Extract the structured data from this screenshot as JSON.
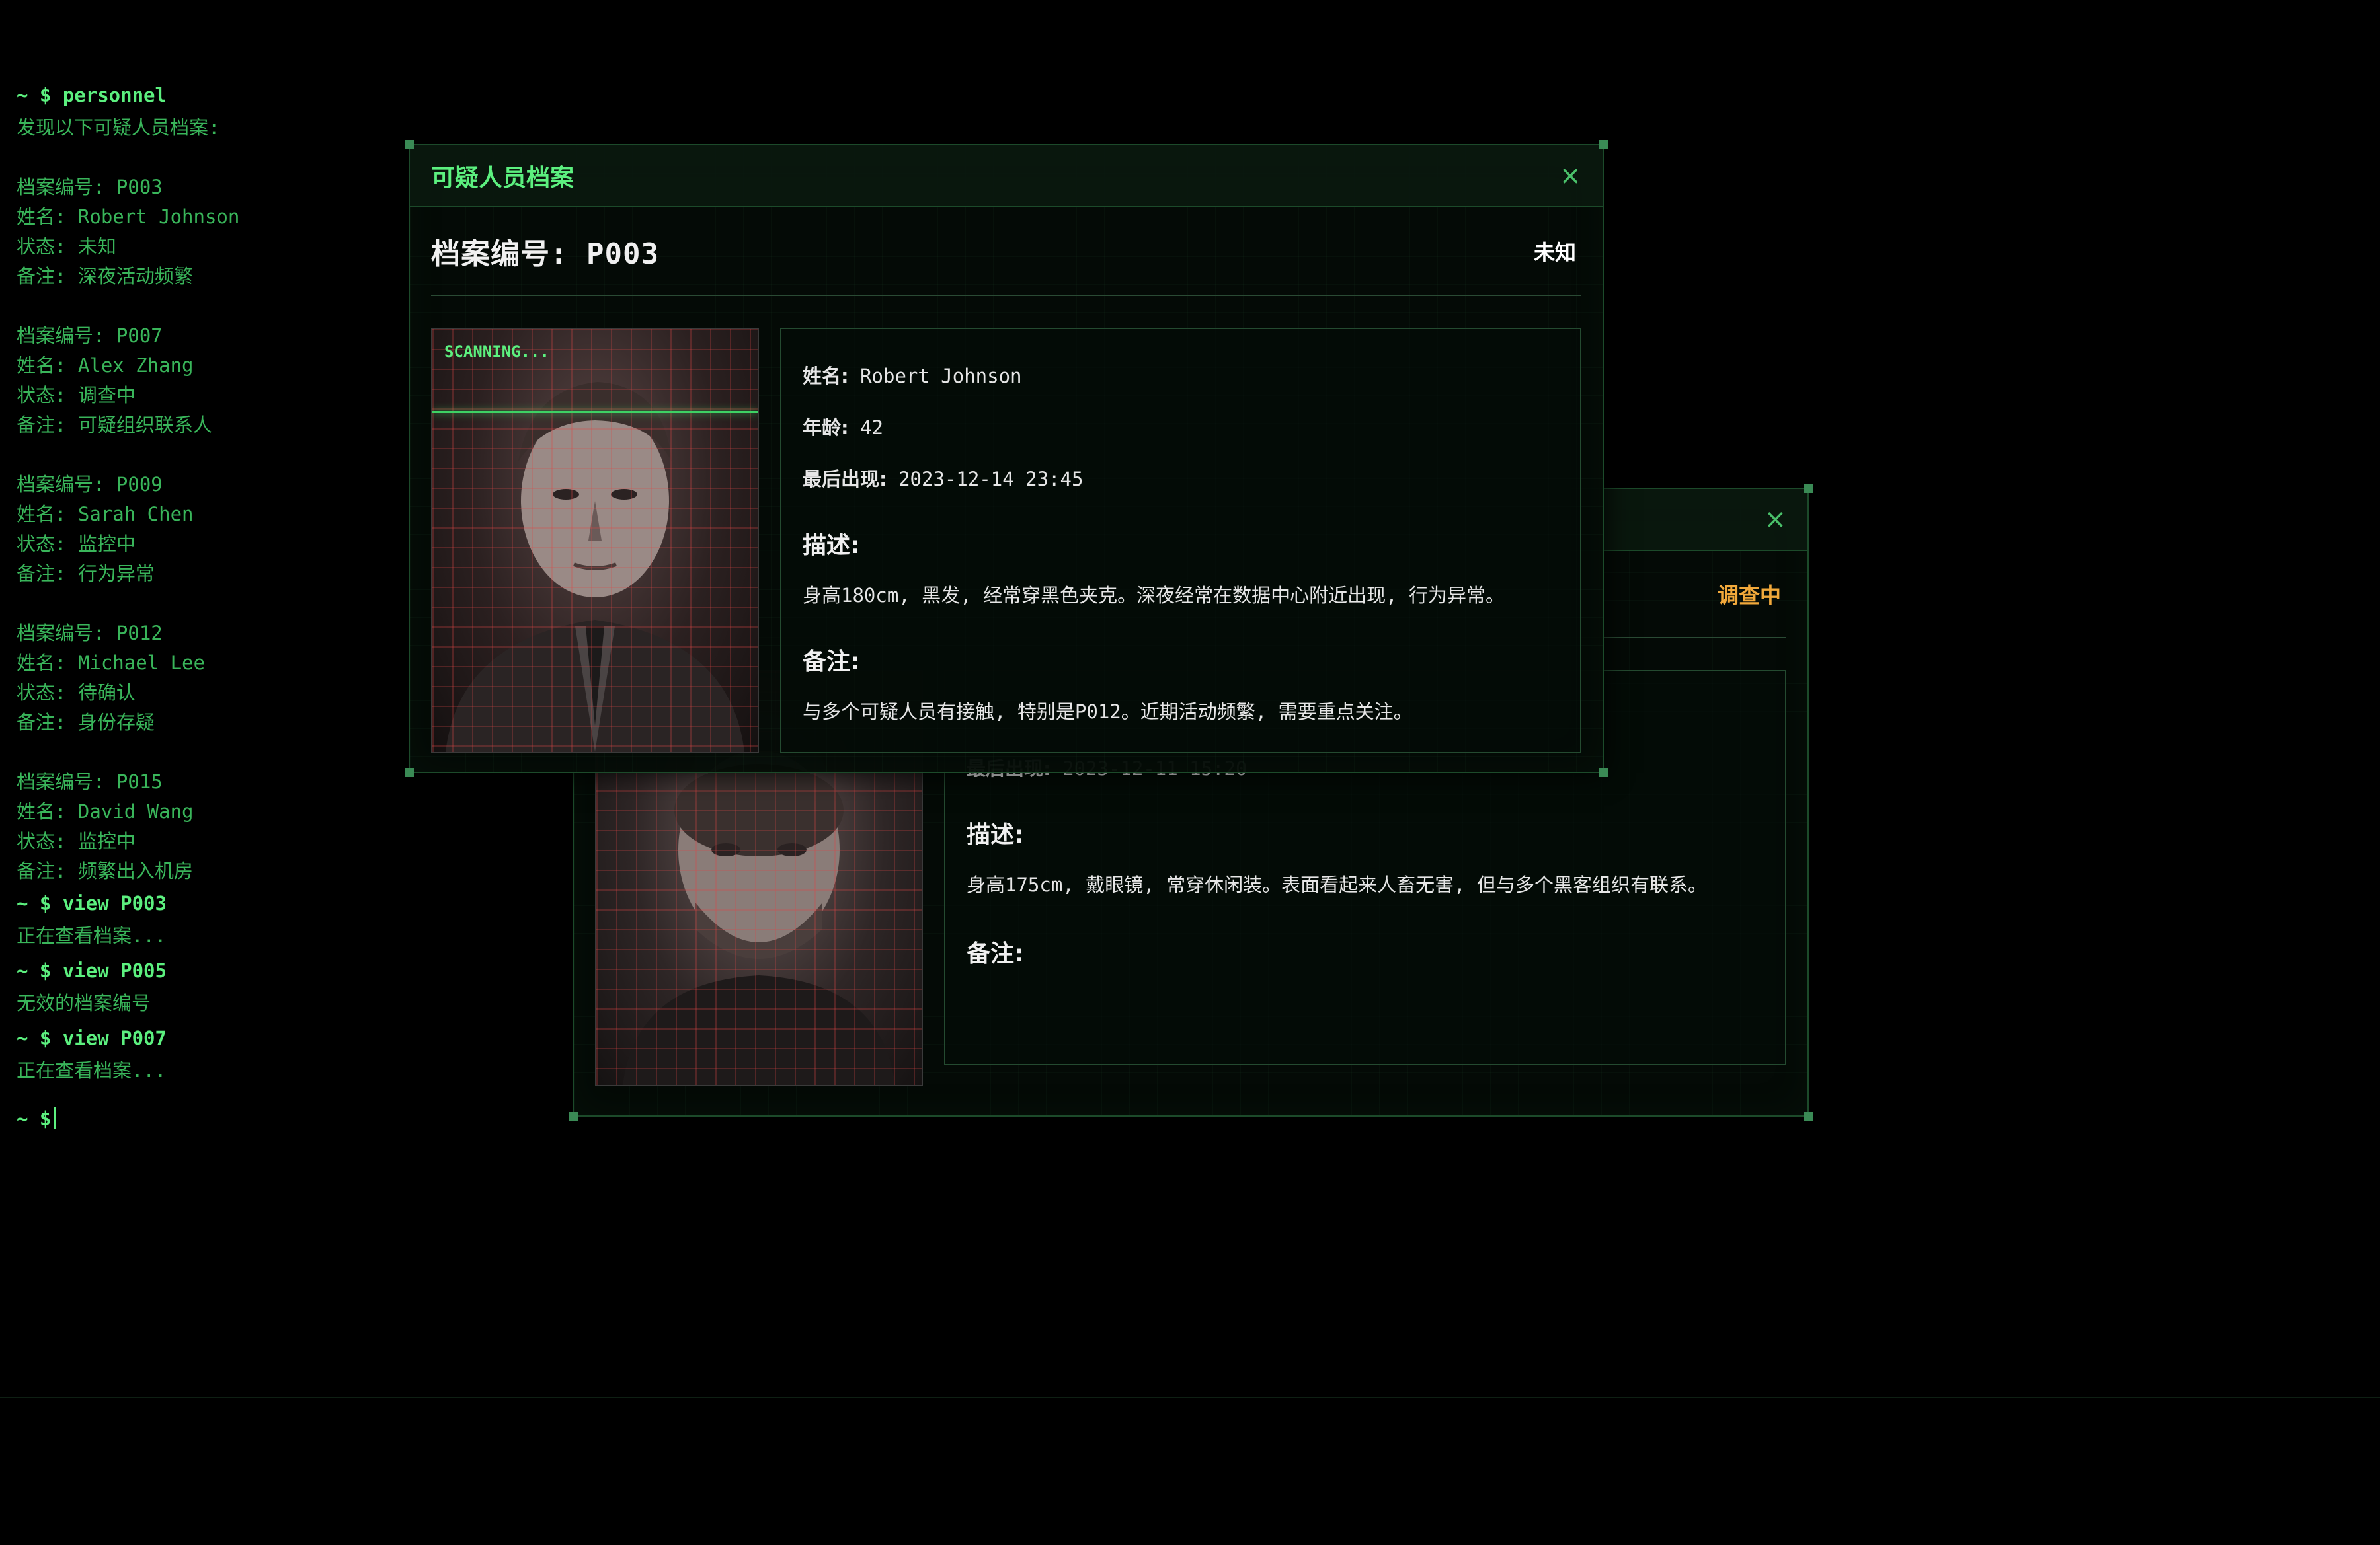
{
  "terminal": {
    "prompt": "~ $",
    "lines": [
      {
        "type": "cmd",
        "text": "~ $ personnel"
      },
      {
        "type": "out",
        "text": "发现以下可疑人员档案:"
      },
      {
        "type": "blank",
        "text": ""
      },
      {
        "type": "out",
        "text": "档案编号: P003"
      },
      {
        "type": "out",
        "text": "姓名: Robert Johnson"
      },
      {
        "type": "out",
        "text": "状态: 未知"
      },
      {
        "type": "out",
        "text": "备注: 深夜活动频繁"
      },
      {
        "type": "blank",
        "text": ""
      },
      {
        "type": "out",
        "text": "档案编号: P007"
      },
      {
        "type": "out",
        "text": "姓名: Alex Zhang"
      },
      {
        "type": "out",
        "text": "状态: 调查中"
      },
      {
        "type": "out",
        "text": "备注: 可疑组织联系人"
      },
      {
        "type": "blank",
        "text": ""
      },
      {
        "type": "out",
        "text": "档案编号: P009"
      },
      {
        "type": "out",
        "text": "姓名: Sarah Chen"
      },
      {
        "type": "out",
        "text": "状态: 监控中"
      },
      {
        "type": "out",
        "text": "备注: 行为异常"
      },
      {
        "type": "blank",
        "text": ""
      },
      {
        "type": "out",
        "text": "档案编号: P012"
      },
      {
        "type": "out",
        "text": "姓名: Michael Lee"
      },
      {
        "type": "out",
        "text": "状态: 待确认"
      },
      {
        "type": "out",
        "text": "备注: 身份存疑"
      },
      {
        "type": "blank",
        "text": ""
      },
      {
        "type": "out",
        "text": "档案编号: P015"
      },
      {
        "type": "out",
        "text": "姓名: David Wang"
      },
      {
        "type": "out",
        "text": "状态: 监控中"
      },
      {
        "type": "out",
        "text": "备注: 频繁出入机房"
      },
      {
        "type": "cmd",
        "text": "~ $ view P003"
      },
      {
        "type": "resp",
        "text": "正在查看档案..."
      },
      {
        "type": "cmd",
        "text": "~ $ view P005"
      },
      {
        "type": "resp",
        "text": "无效的档案编号"
      },
      {
        "type": "cmd",
        "text": "~ $ view P007"
      },
      {
        "type": "resp",
        "text": "正在查看档案..."
      }
    ]
  },
  "window_front": {
    "title": "可疑人员档案",
    "close": "×",
    "file_id": "档案编号: P003",
    "status": "未知",
    "status_color": "#ffffff",
    "scan_label": "SCANNING...",
    "name_label": "姓名:",
    "name": "Robert Johnson",
    "age_label": "年龄:",
    "age": "42",
    "last_seen_label": "最后出现:",
    "last_seen": "2023-12-14 23:45",
    "desc_title": "描述:",
    "desc": "身高180cm, 黑发, 经常穿黑色夹克。深夜经常在数据中心附近出现, 行为异常。",
    "notes_title": "备注:",
    "notes": "与多个可疑人员有接触, 特别是P012。近期活动频繁, 需要重点关注。"
  },
  "window_back": {
    "close": "×",
    "status": "调查中",
    "status_color": "#f2a93b",
    "last_seen_label": "最后出现:",
    "last_seen": "2023-12-11 15:20",
    "desc_title": "描述:",
    "desc": "身高175cm, 戴眼镜, 常穿休闲装。表面看起来人畜无害, 但与多个黑客组织有联系。",
    "notes_title": "备注:"
  },
  "colors": {
    "terminal_text": "#39b55a",
    "terminal_cmd": "#5cf07f",
    "accent": "#5cf07f",
    "border": "#1c4a2a"
  }
}
